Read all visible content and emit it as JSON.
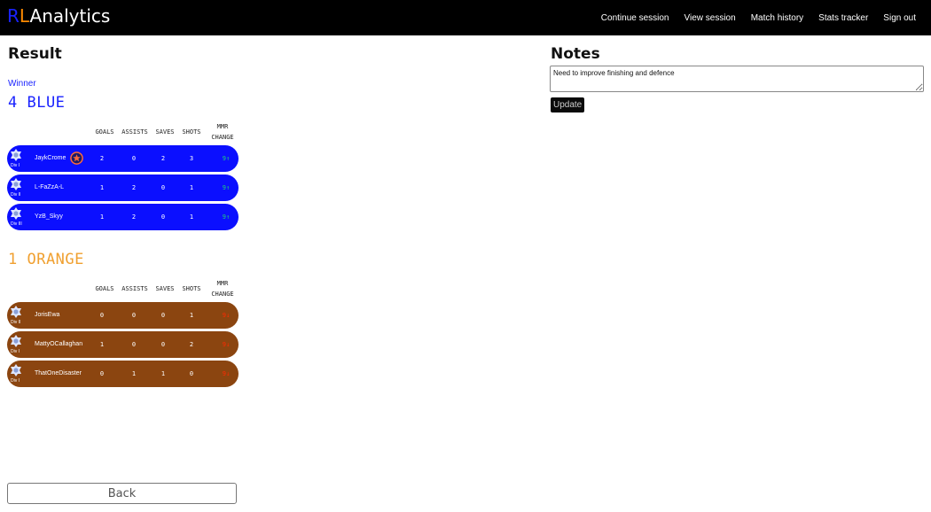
{
  "brand": {
    "r": "R",
    "l": "L",
    "rest": "Analytics"
  },
  "nav": {
    "items": [
      "Continue session",
      "View session",
      "Match history",
      "Stats tracker",
      "Sign out"
    ]
  },
  "result": {
    "title": "Result",
    "winner_label": "Winner",
    "headers": {
      "goals": "GOALS",
      "assists": "ASSISTS",
      "saves": "SAVES",
      "shots": "SHOTS",
      "mmr_line1": "MMR",
      "mmr_line2": "CHANGE"
    },
    "blue": {
      "title": "4 BLUE",
      "color": "#0b0fff",
      "players": [
        {
          "name": "JaykCrome",
          "div": "Div I",
          "goals": "2",
          "assists": "0",
          "saves": "2",
          "shots": "3",
          "mmr": "9↑",
          "mvp": true
        },
        {
          "name": "L-FaZzA-L",
          "div": "Div II",
          "goals": "1",
          "assists": "2",
          "saves": "0",
          "shots": "1",
          "mmr": "9↑",
          "mvp": false
        },
        {
          "name": "YzB_Skyy",
          "div": "Div III",
          "goals": "1",
          "assists": "2",
          "saves": "0",
          "shots": "1",
          "mmr": "9↑",
          "mvp": false
        }
      ]
    },
    "orange": {
      "title": "1 ORANGE",
      "color": "#8b4510",
      "players": [
        {
          "name": "JorisEwa",
          "div": "Div II",
          "goals": "0",
          "assists": "0",
          "saves": "0",
          "shots": "1",
          "mmr": "9↓"
        },
        {
          "name": "MattyOCallaghan",
          "div": "Div I",
          "goals": "1",
          "assists": "0",
          "saves": "0",
          "shots": "2",
          "mmr": "9↓"
        },
        {
          "name": "ThatOneDisaster",
          "div": "Div I",
          "goals": "0",
          "assists": "1",
          "saves": "1",
          "shots": "0",
          "mmr": "9↓"
        }
      ]
    }
  },
  "notes": {
    "title": "Notes",
    "value": "Need to improve finishing and defence",
    "update_label": "Update"
  },
  "back_label": "Back",
  "colors": {
    "blue_text": "#1a23ff",
    "orange_text": "#f0a030",
    "mmr_up": "#1ed27a",
    "mmr_down": "#ff2a00"
  }
}
